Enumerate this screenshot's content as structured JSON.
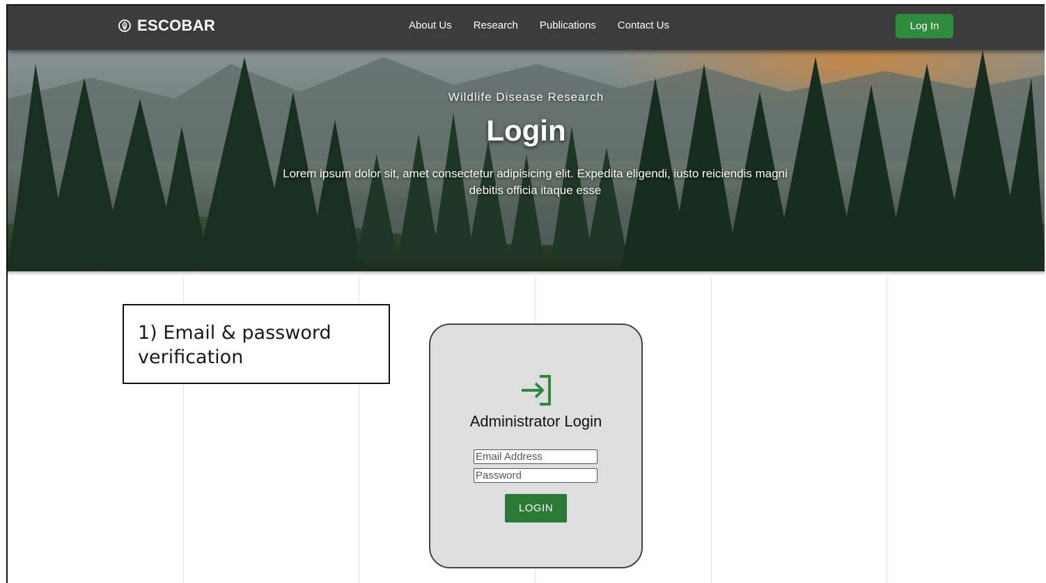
{
  "navbar": {
    "brand": "ESCOBAR",
    "links": [
      "About Us",
      "Research",
      "Publications",
      "Contact Us"
    ],
    "login_label": "Log In"
  },
  "hero": {
    "subtitle": "Wildlife Disease Research",
    "title": "Login",
    "description": "Lorem ipsum dolor sit, amet consectetur adipisicing elit. Expedita eligendi, iusto reiciendis magni debitis officia itaque esse"
  },
  "annotation": {
    "text": "1) Email & password verification"
  },
  "login_card": {
    "icon": "login-arrow-icon",
    "title": "Administrator Login",
    "email_placeholder": "Email Address",
    "password_placeholder": "Password",
    "button_label": "LOGIN"
  },
  "colors": {
    "navbar_bg": "#3c3c3c",
    "accent_green": "#2e8b3e",
    "card_bg": "#dedede"
  }
}
